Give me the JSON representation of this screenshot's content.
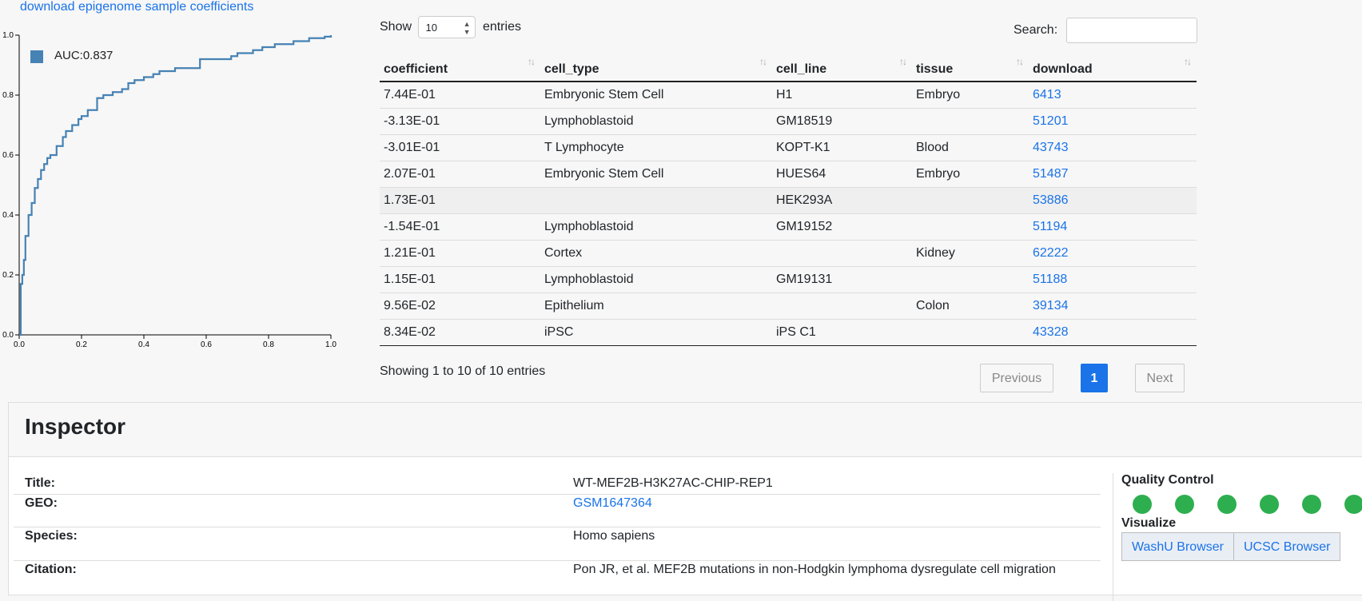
{
  "download_link": "download epigenome sample coefficients",
  "chart_data": {
    "type": "line",
    "legend": "AUC:0.837",
    "xlim": [
      0,
      1
    ],
    "ylim": [
      0,
      1
    ],
    "x_ticks": [
      "0.0",
      "0.2",
      "0.4",
      "0.6",
      "0.8",
      "1.0"
    ],
    "y_ticks": [
      "0.0",
      "0.2",
      "0.4",
      "0.6",
      "0.8",
      "1.0"
    ],
    "color": "#4682b4",
    "x": [
      0,
      0.005,
      0.01,
      0.015,
      0.02,
      0.03,
      0.04,
      0.05,
      0.06,
      0.07,
      0.08,
      0.09,
      0.1,
      0.12,
      0.14,
      0.15,
      0.17,
      0.19,
      0.2,
      0.22,
      0.25,
      0.27,
      0.3,
      0.33,
      0.35,
      0.37,
      0.4,
      0.43,
      0.45,
      0.48,
      0.5,
      0.55,
      0.58,
      0.62,
      0.65,
      0.68,
      0.7,
      0.73,
      0.75,
      0.78,
      0.8,
      0.82,
      0.85,
      0.88,
      0.9,
      0.93,
      0.96,
      0.98,
      1.0
    ],
    "y": [
      0,
      0.17,
      0.2,
      0.25,
      0.33,
      0.4,
      0.44,
      0.49,
      0.52,
      0.55,
      0.57,
      0.59,
      0.6,
      0.63,
      0.66,
      0.68,
      0.7,
      0.72,
      0.73,
      0.75,
      0.79,
      0.8,
      0.81,
      0.82,
      0.84,
      0.85,
      0.86,
      0.87,
      0.88,
      0.88,
      0.89,
      0.89,
      0.92,
      0.92,
      0.92,
      0.93,
      0.94,
      0.94,
      0.95,
      0.96,
      0.96,
      0.97,
      0.97,
      0.98,
      0.98,
      0.99,
      0.99,
      0.995,
      1.0
    ]
  },
  "table": {
    "show_label": "Show",
    "show_value": "10",
    "entries_label": "entries",
    "search_label": "Search:",
    "columns": [
      "coefficient",
      "cell_type",
      "cell_line",
      "tissue",
      "download"
    ],
    "rows": [
      [
        "7.44E-01",
        "Embryonic Stem Cell",
        "H1",
        "Embryo",
        "6413"
      ],
      [
        "-3.13E-01",
        "Lymphoblastoid",
        "GM18519",
        "",
        "51201"
      ],
      [
        "-3.01E-01",
        "T Lymphocyte",
        "KOPT-K1",
        "Blood",
        "43743"
      ],
      [
        "2.07E-01",
        "Embryonic Stem Cell",
        "HUES64",
        "Embryo",
        "51487"
      ],
      [
        "1.73E-01",
        "",
        "HEK293A",
        "",
        "53886"
      ],
      [
        "-1.54E-01",
        "Lymphoblastoid",
        "GM19152",
        "",
        "51194"
      ],
      [
        "1.21E-01",
        "Cortex",
        "",
        "Kidney",
        "62222"
      ],
      [
        "1.15E-01",
        "Lymphoblastoid",
        "GM19131",
        "",
        "51188"
      ],
      [
        "9.56E-02",
        "Epithelium",
        "",
        "Colon",
        "39134"
      ],
      [
        "8.34E-02",
        "iPSC",
        "iPS C1",
        "",
        "43328"
      ]
    ],
    "info": "Showing 1 to 10 of 10 entries",
    "pagination": {
      "previous": "Previous",
      "current": "1",
      "next": "Next"
    }
  },
  "inspector": {
    "title": "Inspector",
    "fields": [
      {
        "label": "Title:",
        "value": "WT-MEF2B-H3K27AC-CHIP-REP1"
      },
      {
        "label": "GEO:",
        "value": "GSM1647364"
      },
      {
        "label": "Species:",
        "value": "Homo sapiens"
      },
      {
        "label": "Citation:",
        "value": "Pon JR, et al. MEF2B mutations in non-Hodgkin lymphoma dysregulate cell migration"
      }
    ],
    "quality_control_label": "Quality Control",
    "qc_color": "#2eaf4f",
    "visualize_label": "Visualize",
    "buttons": [
      "WashU Browser",
      "UCSC Browser"
    ]
  }
}
